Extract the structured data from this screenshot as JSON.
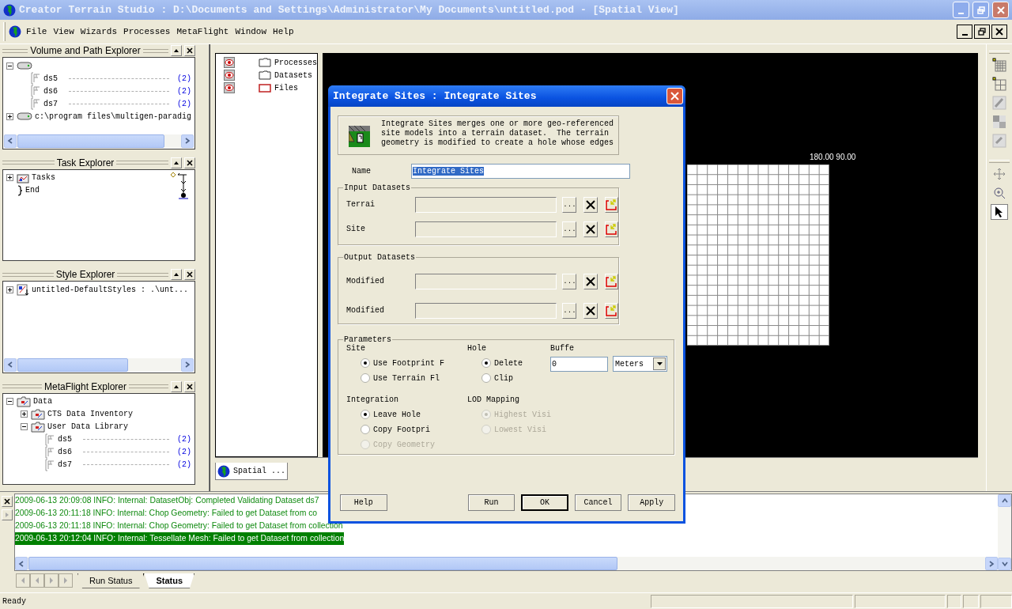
{
  "window": {
    "title": "Creator Terrain Studio : D:\\Documents and Settings\\Administrator\\My Documents\\untitled.pod - [Spatial View]"
  },
  "menu": [
    "File",
    "View",
    "Wizards",
    "Processes",
    "MetaFlight",
    "Window",
    "Help"
  ],
  "panels": [
    {
      "title": "Volume and Path Explorer",
      "has_scrollbar": true,
      "tree": [
        {
          "kind": "drive",
          "expanded": true,
          "children": [
            {
              "kind": "dataset",
              "label": "ds5",
              "count": "(2)"
            },
            {
              "kind": "dataset",
              "label": "ds6",
              "count": "(2)"
            },
            {
              "kind": "dataset",
              "label": "ds7",
              "count": "(2)"
            }
          ]
        },
        {
          "kind": "drive",
          "label": "c:\\program files\\multigen-paradig",
          "expanded": false
        }
      ]
    },
    {
      "title": "Task Explorer",
      "has_scrollbar": false,
      "tree": [
        {
          "kind": "task",
          "label": "Tasks",
          "expanded": false
        },
        {
          "kind": "end",
          "label": "End"
        }
      ]
    },
    {
      "title": "Style Explorer",
      "has_scrollbar": true,
      "tree": [
        {
          "kind": "style",
          "label": "untitled-DefaultStyles : .\\unt...",
          "expanded": false
        }
      ]
    },
    {
      "title": "MetaFlight Explorer",
      "has_scrollbar": false,
      "tree": [
        {
          "kind": "folder",
          "label": "Data",
          "expanded": true,
          "children": [
            {
              "kind": "folder",
              "label": "CTS Data Inventory",
              "expanded": false
            },
            {
              "kind": "folder",
              "label": "User Data Library",
              "expanded": true,
              "children": [
                {
                  "kind": "dataset",
                  "label": "ds5",
                  "count": "(2)"
                },
                {
                  "kind": "dataset",
                  "label": "ds6",
                  "count": "(2)"
                },
                {
                  "kind": "dataset",
                  "label": "ds7",
                  "count": "(2)"
                }
              ]
            }
          ]
        }
      ]
    }
  ],
  "spatial_view": {
    "tree": [
      {
        "kind": "folder",
        "label": "Processes"
      },
      {
        "kind": "folder",
        "label": "Datasets"
      },
      {
        "kind": "files",
        "label": "Files"
      }
    ],
    "grid_label": "180.00 90.00",
    "tab": "Spatial ..."
  },
  "dialog": {
    "title": "Integrate Sites : Integrate Sites",
    "description": "Integrate Sites merges one or more geo-referenced site models into a terrain dataset.  The terrain geometry is modified to create a hole whose edges",
    "name": {
      "label": "Name",
      "value": "Integrate Sites",
      "highlighted": true
    },
    "groups": [
      {
        "title": "Input Datasets",
        "rows": [
          {
            "label": "Terrai",
            "browse": "..."
          },
          {
            "label": "Site",
            "browse": "..."
          }
        ]
      },
      {
        "title": "Output Datasets",
        "rows": [
          {
            "label": "Modified",
            "browse": "..."
          },
          {
            "label": "Modified",
            "browse": "..."
          }
        ]
      }
    ],
    "parameters": {
      "title": "Parameters",
      "option_groups": [
        {
          "title": "Site",
          "options": [
            {
              "label": "Use Footprint F",
              "selected": true,
              "disabled": false
            },
            {
              "label": "Use Terrain Fl",
              "selected": false,
              "disabled": false
            }
          ]
        },
        {
          "title": "Hole",
          "options": [
            {
              "label": "Delete",
              "selected": true,
              "disabled": false
            },
            {
              "label": "Clip",
              "selected": false,
              "disabled": false
            }
          ]
        },
        {
          "title": "Integration",
          "options": [
            {
              "label": "Leave Hole",
              "selected": true,
              "disabled": false
            },
            {
              "label": "Copy Footpri",
              "selected": false,
              "disabled": false
            },
            {
              "label": "Copy Geometry",
              "selected": false,
              "disabled": true
            }
          ]
        },
        {
          "title": "LOD Mapping",
          "options": [
            {
              "label": "Highest Visi",
              "selected": true,
              "disabled": true
            },
            {
              "label": "Lowest Visi",
              "selected": false,
              "disabled": true
            }
          ]
        }
      ],
      "buffer": {
        "label": "Buffe",
        "value": "0",
        "unit": "Meters"
      }
    },
    "buttons": [
      {
        "label": "Help",
        "default": false
      },
      {
        "label": "Run",
        "default": false
      },
      {
        "label": "OK",
        "default": true
      },
      {
        "label": "Cancel",
        "default": false
      },
      {
        "label": "Apply",
        "default": false
      }
    ]
  },
  "log": {
    "lines": [
      {
        "text": "2009-06-13 20:09:08 INFO: Internal: DatasetObj: Completed Validating Dataset ds7",
        "selected": false
      },
      {
        "text": "2009-06-13 20:11:18 INFO: Internal: Chop Geometry: Failed to get Dataset from co",
        "selected": false
      },
      {
        "text": "2009-06-13 20:11:18 INFO: Internal: Chop Geometry: Failed to get Dataset from collection",
        "selected": false
      },
      {
        "text": "2009-06-13 20:12:04 INFO: Internal: Tessellate Mesh: Failed to get Dataset from collection",
        "selected": true
      }
    ],
    "tabs": [
      {
        "label": "Run Status",
        "selected": false
      },
      {
        "label": "Status",
        "selected": true
      }
    ]
  },
  "status_bar": {
    "text": "Ready"
  }
}
